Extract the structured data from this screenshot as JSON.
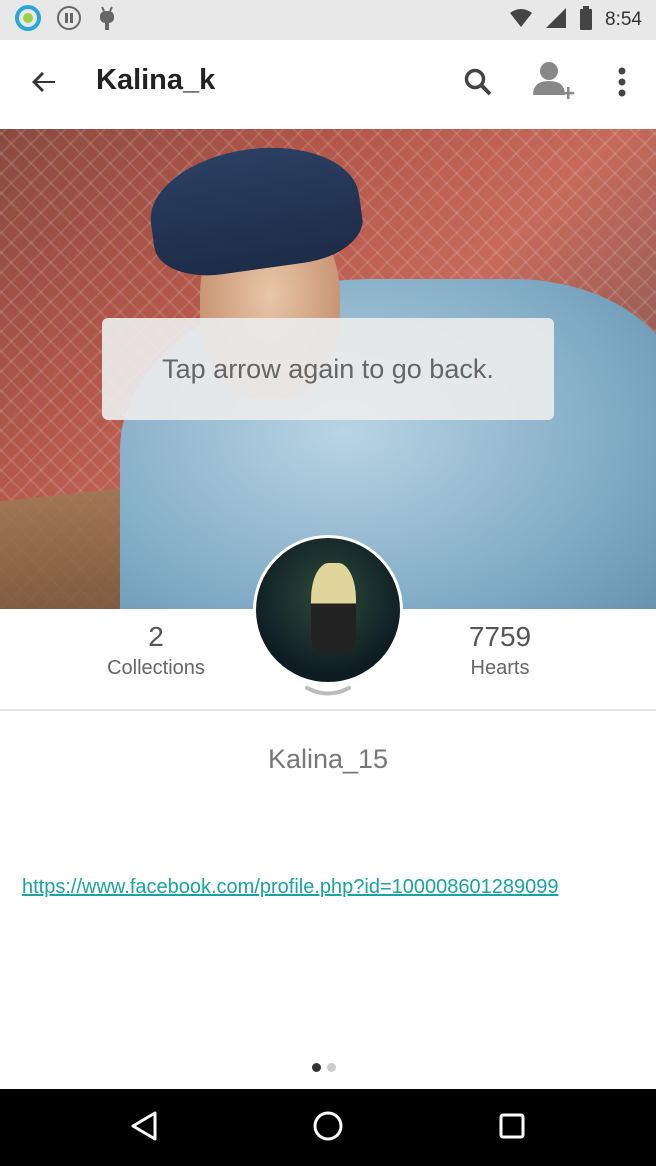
{
  "status_bar": {
    "time": "8:54"
  },
  "app_bar": {
    "title": "Kalina_k"
  },
  "toast": {
    "text": "Tap arrow again to go back."
  },
  "stats": {
    "collections": {
      "count": "2",
      "label": "Collections"
    },
    "hearts": {
      "count": "7759",
      "label": "Hearts"
    }
  },
  "profile": {
    "username": "Kalina_15",
    "link": "https://www.facebook.com/profile.php?id=100008601289099"
  },
  "pager": {
    "page": 1,
    "total": 2
  },
  "colors": {
    "link": "#1aa3a3",
    "status_bar": "#e8e8e8",
    "nav_bar": "#000000"
  }
}
